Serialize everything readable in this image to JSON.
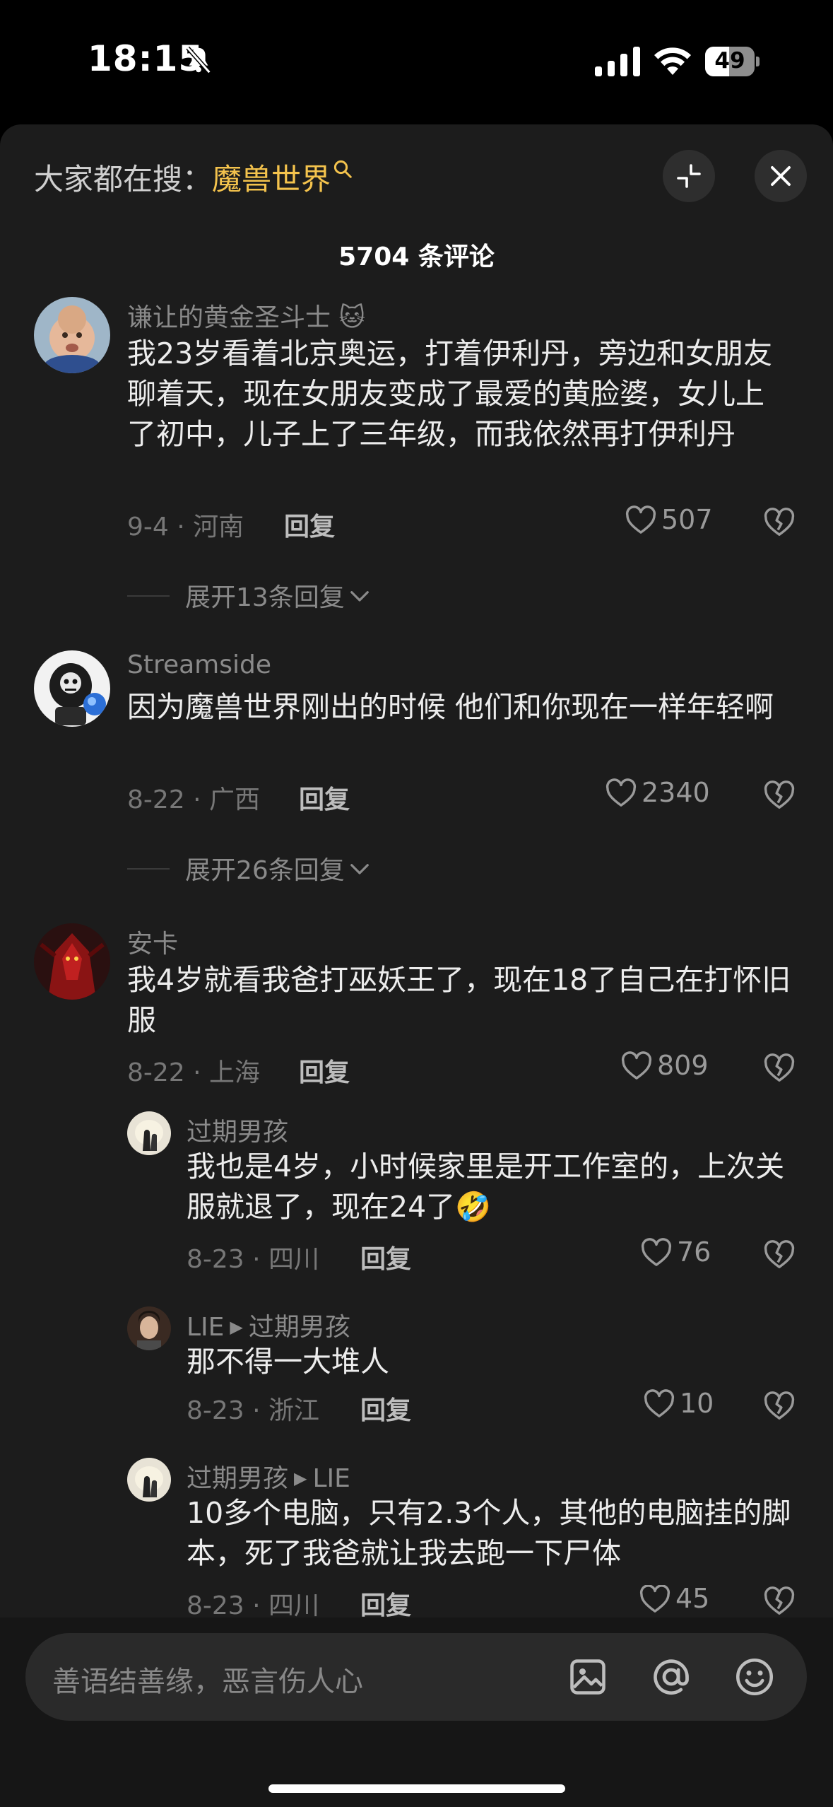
{
  "status_bar": {
    "time": "18:15",
    "battery": "49",
    "battery_level": 0.49
  },
  "header": {
    "search_prefix": "大家都在搜：",
    "search_keyword": "魔兽世界",
    "comment_count": "5704 条评论"
  },
  "comments": [
    {
      "user": "谦让的黄金圣斗士",
      "badge_emoji": "🐱",
      "text": "我23岁看着北京奥运，打着伊利丹，旁边和女朋友聊着天，现在女朋友变成了最爱的黄脸婆，女儿上了初中，儿子上了三年级，而我依然再打伊利丹",
      "meta": "9-4 · 河南",
      "reply_label": "回复",
      "likes": "507",
      "expand": "展开13条回复"
    },
    {
      "user": "Streamside",
      "text": "因为魔兽世界刚出的时候 他们和你现在一样年轻啊",
      "meta": "8-22 · 广西",
      "reply_label": "回复",
      "likes": "2340",
      "expand": "展开26条回复"
    },
    {
      "user": "安卡",
      "text": "我4岁就看我爸打巫妖王了，现在18了自己在打怀旧服",
      "meta": "8-22 · 上海",
      "reply_label": "回复",
      "likes": "809"
    }
  ],
  "replies": [
    {
      "user": "过期男孩",
      "text": "我也是4岁，小时候家里是开工作室的，上次关服就退了，现在24了🤣",
      "meta": "8-23 · 四川",
      "reply_label": "回复",
      "likes": "76"
    },
    {
      "user": "LIE",
      "reply_to": "过期男孩",
      "text": "那不得一大堆人",
      "meta": "8-23 · 浙江",
      "reply_label": "回复",
      "likes": "10"
    },
    {
      "user": "过期男孩",
      "reply_to": "LIE",
      "text": "10多个电脑，只有2.3个人，其他的电脑挂的脚本，死了我爸就让我去跑一下尸体",
      "meta": "8-23 · 四川",
      "reply_label": "回复",
      "likes": "45"
    }
  ],
  "input": {
    "placeholder": "善语结善缘，恶言伤人心"
  },
  "colors": {
    "sheet_bg": "#1c1c1c",
    "keyword": "#f4c34d",
    "muted": "#8a8a8a"
  }
}
